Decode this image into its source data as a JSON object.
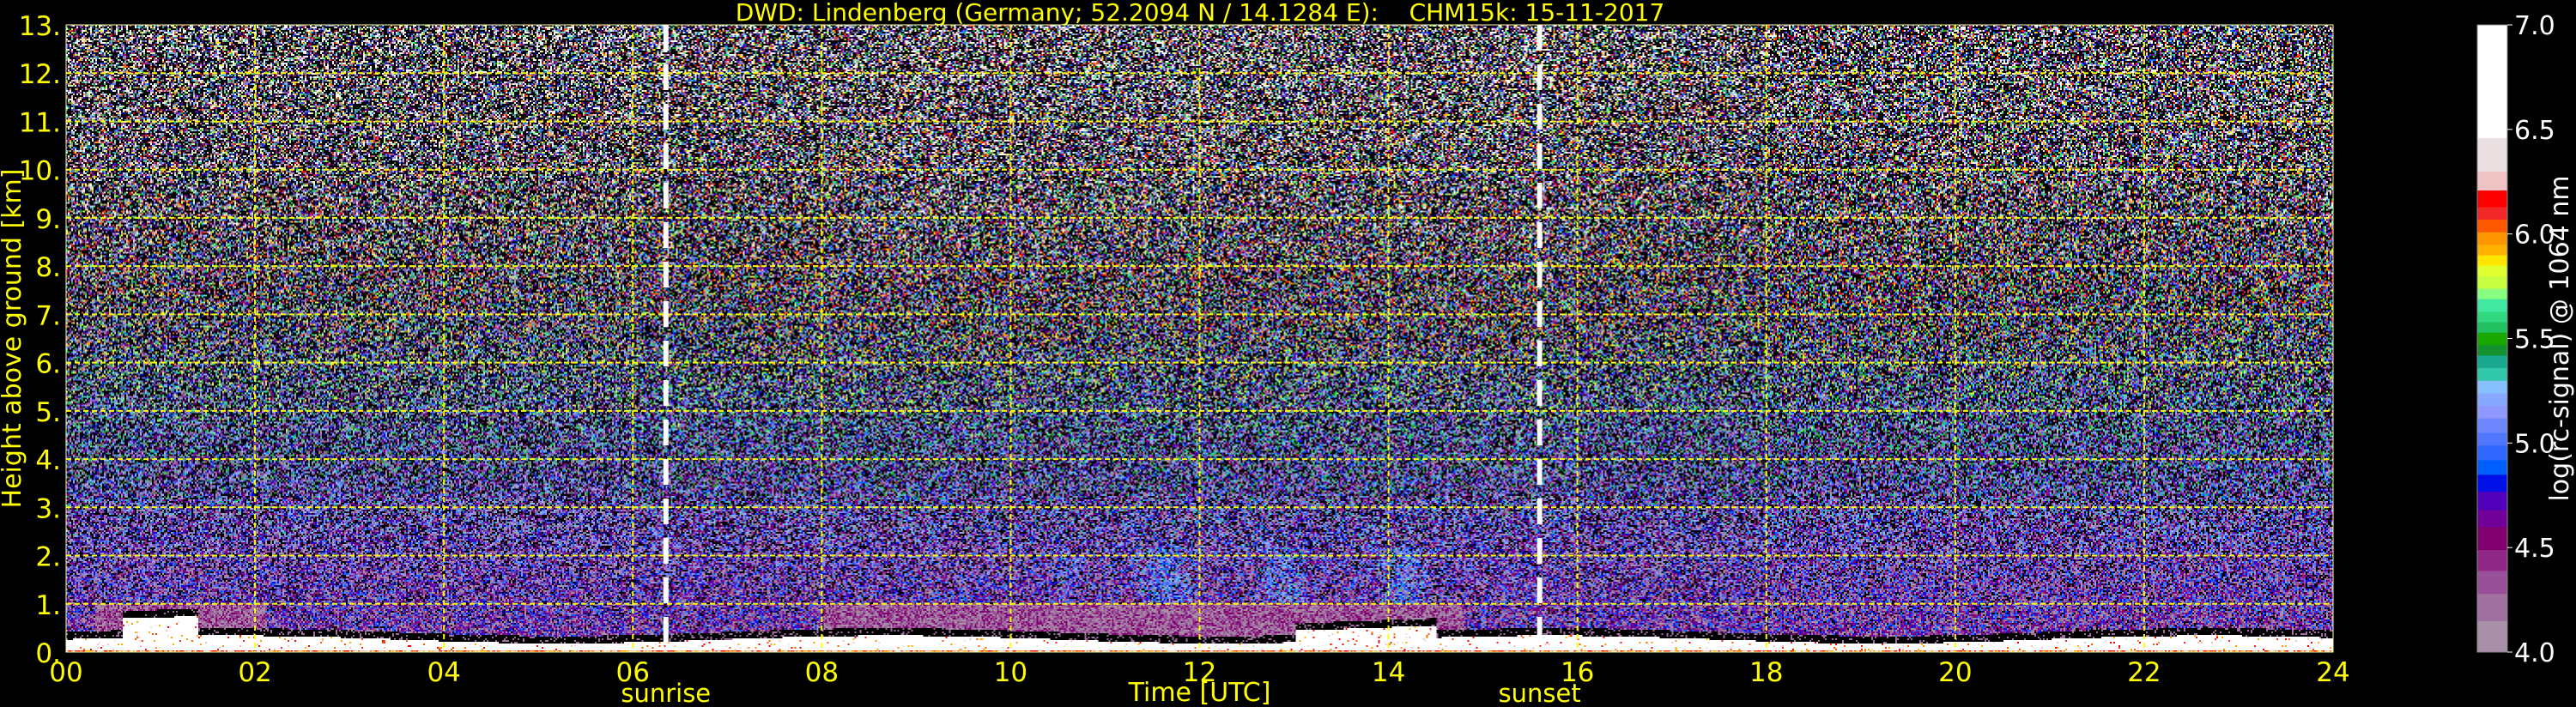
{
  "chart_data": {
    "type": "heatmap",
    "title": "DWD: Lindenberg (Germany; 52.2094 N / 14.1284 E):    CHM15k: 15-11-2017",
    "xlabel": "Time [UTC]",
    "ylabel": "Height above ground [km]",
    "xlim": [
      0,
      24
    ],
    "ylim": [
      0,
      13
    ],
    "x_ticks": [
      0,
      2,
      4,
      6,
      8,
      10,
      12,
      14,
      16,
      18,
      20,
      22,
      24
    ],
    "x_tick_labels": [
      "00",
      "02",
      "04",
      "06",
      "08",
      "10",
      "12",
      "14",
      "16",
      "18",
      "20",
      "22",
      "24"
    ],
    "y_ticks": [
      0,
      1,
      2,
      3,
      4,
      5,
      6,
      7,
      8,
      9,
      10,
      11,
      12,
      13
    ],
    "y_tick_labels": [
      "0.",
      "1.",
      "2.",
      "3.",
      "4.",
      "5.",
      "6.",
      "7.",
      "8.",
      "9.",
      "10.",
      "11.",
      "12.",
      "13."
    ],
    "grid": true,
    "annotations": [
      {
        "label": "sunrise",
        "x": 6.35
      },
      {
        "label": "sunset",
        "x": 15.6
      }
    ],
    "colorbar": {
      "label": "log(rc-signal) @ 1064 nm",
      "range": [
        4.0,
        7.0
      ],
      "tick_labels": [
        "4.0",
        "4.5",
        "5.0",
        "5.5",
        "6.0",
        "6.5",
        "7.0"
      ],
      "ticks": [
        4.0,
        4.5,
        5.0,
        5.5,
        6.0,
        6.5,
        7.0
      ],
      "segments": [
        {
          "from": 4.0,
          "color": "#a890a8"
        },
        {
          "from": 4.15,
          "color": "#a070a0"
        },
        {
          "from": 4.28,
          "color": "#985098"
        },
        {
          "from": 4.39,
          "color": "#902888"
        },
        {
          "from": 4.49,
          "color": "#800070"
        },
        {
          "from": 4.6,
          "color": "#700098"
        },
        {
          "from": 4.68,
          "color": "#5000b8"
        },
        {
          "from": 4.77,
          "color": "#0010e8"
        },
        {
          "from": 4.85,
          "color": "#0060ff"
        },
        {
          "from": 4.92,
          "color": "#3068ff"
        },
        {
          "from": 4.99,
          "color": "#5078ff"
        },
        {
          "from": 5.05,
          "color": "#7088ff"
        },
        {
          "from": 5.12,
          "color": "#9098ff"
        },
        {
          "from": 5.18,
          "color": "#88a8ff"
        },
        {
          "from": 5.24,
          "color": "#88c0ff"
        },
        {
          "from": 5.3,
          "color": "#30c8a8"
        },
        {
          "from": 5.36,
          "color": "#1aa890"
        },
        {
          "from": 5.42,
          "color": "#139030"
        },
        {
          "from": 5.47,
          "color": "#18a800"
        },
        {
          "from": 5.53,
          "color": "#20c060"
        },
        {
          "from": 5.58,
          "color": "#30d880"
        },
        {
          "from": 5.63,
          "color": "#40e8a0"
        },
        {
          "from": 5.69,
          "color": "#88ff80"
        },
        {
          "from": 5.74,
          "color": "#c8ff40"
        },
        {
          "from": 5.8,
          "color": "#e0ff30"
        },
        {
          "from": 5.85,
          "color": "#ffe600"
        },
        {
          "from": 5.9,
          "color": "#ffb000"
        },
        {
          "from": 5.95,
          "color": "#ff9600"
        },
        {
          "from": 6.01,
          "color": "#ff5a00"
        },
        {
          "from": 6.07,
          "color": "#f02828"
        },
        {
          "from": 6.13,
          "color": "#ff0000"
        },
        {
          "from": 6.21,
          "color": "#f0c4c4"
        },
        {
          "from": 6.3,
          "color": "#ebe1e3"
        },
        {
          "from": 6.46,
          "color": "#ffffff"
        }
      ]
    }
  },
  "colors": {
    "axis_text": "#ffff00",
    "grid": "#ffff00",
    "colorbar_text": "#ffffff",
    "marker_line": "#ffffff"
  }
}
